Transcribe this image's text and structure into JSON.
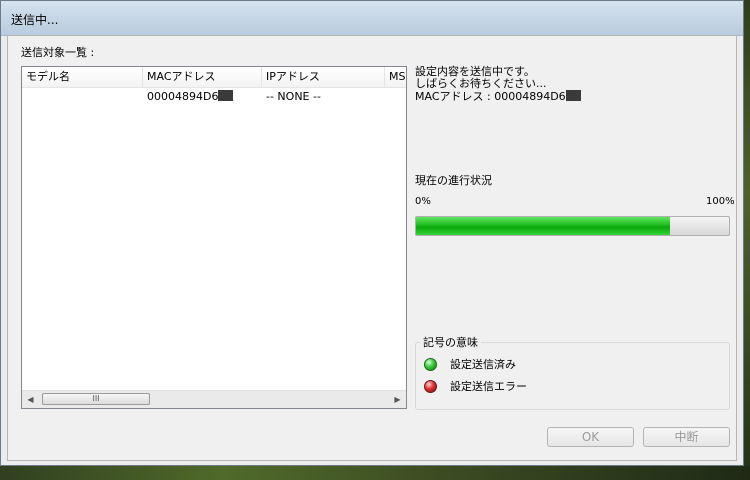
{
  "window": {
    "title": "送信中..."
  },
  "targets": {
    "label": "送信対象一覧 :",
    "columns": [
      "モデル名",
      "MACアドレス",
      "IPアドレス",
      "MS"
    ],
    "rows": [
      {
        "model": "",
        "mac": "00004894D6",
        "ip": "-- NONE --"
      }
    ],
    "scroll_left": "◀",
    "scroll_right": "▶",
    "scroll_thumb": "III"
  },
  "status": {
    "line1": "設定内容を送信中です。",
    "line2": "しばらくお待ちください...",
    "line3": "MACアドレス : 00004894D6"
  },
  "progress": {
    "title": "現在の進行状況",
    "min_label": "0%",
    "max_label": "100%",
    "value_percent": 81
  },
  "legend": {
    "title": "記号の意味",
    "items": [
      {
        "label": "設定送信済み",
        "color": "#39c839",
        "icon": "green-status-icon"
      },
      {
        "label": "設定送信エラー",
        "color": "#e03030",
        "icon": "red-status-icon"
      }
    ]
  },
  "buttons": {
    "ok": "OK",
    "cancel": "中断"
  }
}
